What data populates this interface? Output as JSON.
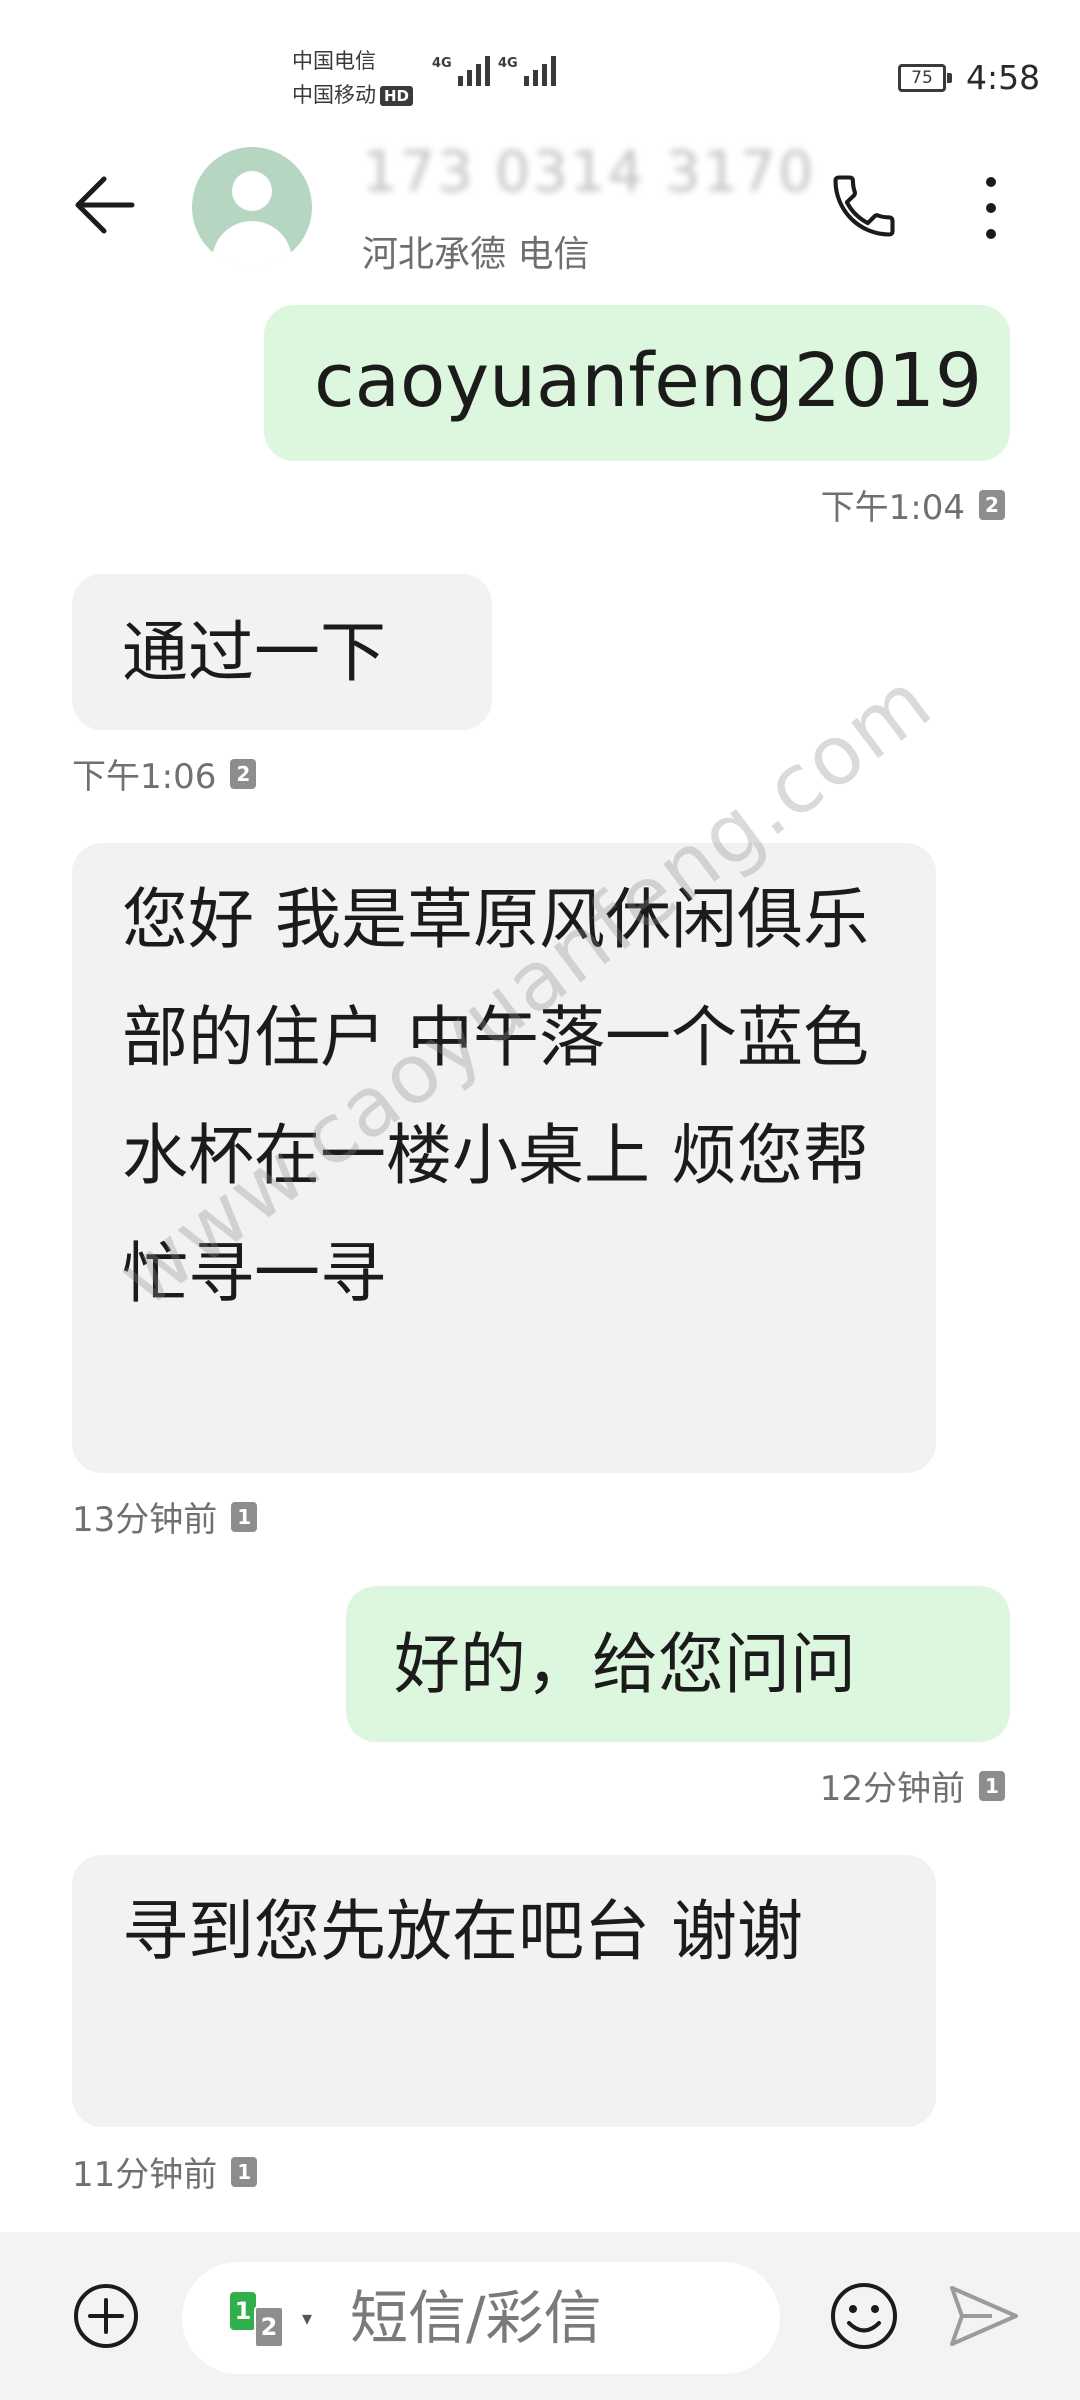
{
  "status_bar": {
    "carrier_1": "中国电信",
    "carrier_2": "中国移动",
    "hd_badge": "HD",
    "network_1": "4G",
    "network_2": "4G",
    "battery": "75",
    "time": "4:58"
  },
  "header": {
    "contact_number": "173 0314 3170",
    "contact_location": "河北承德 电信",
    "icons": {
      "back": "back-arrow-icon",
      "call": "phone-icon",
      "more": "more-vertical-icon"
    }
  },
  "messages": [
    {
      "direction": "outgoing",
      "text": "caoyuanfeng2019",
      "time": "下午1:04",
      "sim": "2"
    },
    {
      "direction": "incoming",
      "text": "通过一下",
      "time": "下午1:06",
      "sim": "2"
    },
    {
      "direction": "incoming",
      "text": "您好 我是草原风休闲俱乐部的住户 中午落一个蓝色水杯在一楼小桌上 烦您帮忙寻一寻",
      "time": "13分钟前",
      "sim": "1"
    },
    {
      "direction": "outgoing",
      "text": "好的，给您问问",
      "time": "12分钟前",
      "sim": "1"
    },
    {
      "direction": "incoming",
      "text": "寻到您先放在吧台 谢谢",
      "time": "11分钟前",
      "sim": "1"
    }
  ],
  "watermark": "www.caoyuanfeng.com",
  "composer": {
    "sim_primary": "1",
    "sim_secondary": "2",
    "placeholder": "短信/彩信",
    "icons": {
      "add": "add-circle-icon",
      "emoji": "emoji-icon",
      "send": "send-icon"
    }
  },
  "colors": {
    "outgoing_bubble": "#dcf7de",
    "incoming_bubble": "#f2f2f2",
    "sim_active": "#2fb04a"
  }
}
